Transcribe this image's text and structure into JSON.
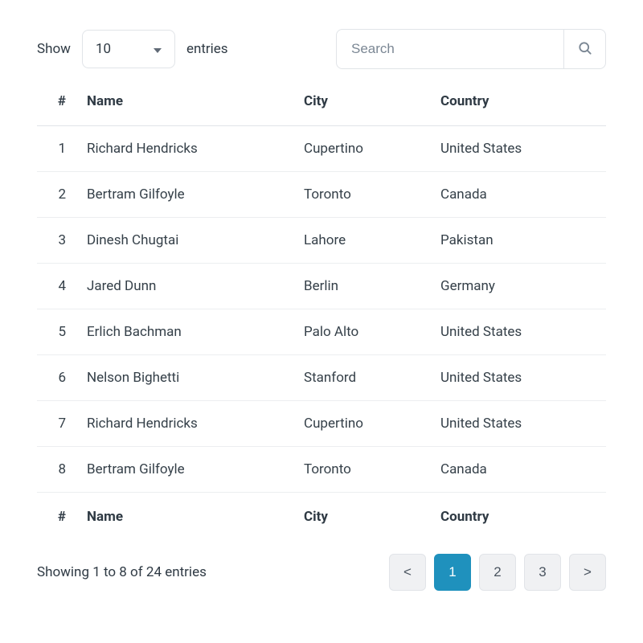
{
  "length": {
    "prefix": "Show",
    "value": "10",
    "suffix": "entries"
  },
  "search": {
    "placeholder": "Search",
    "value": ""
  },
  "columns": {
    "idx": "#",
    "name": "Name",
    "city": "City",
    "country": "Country"
  },
  "rows": [
    {
      "idx": "1",
      "name": "Richard Hendricks",
      "city": "Cupertino",
      "country": "United States"
    },
    {
      "idx": "2",
      "name": "Bertram Gilfoyle",
      "city": "Toronto",
      "country": "Canada"
    },
    {
      "idx": "3",
      "name": "Dinesh Chugtai",
      "city": "Lahore",
      "country": "Pakistan"
    },
    {
      "idx": "4",
      "name": "Jared Dunn",
      "city": "Berlin",
      "country": "Germany"
    },
    {
      "idx": "5",
      "name": "Erlich Bachman",
      "city": "Palo Alto",
      "country": "United States"
    },
    {
      "idx": "6",
      "name": "Nelson Bighetti",
      "city": "Stanford",
      "country": "United States"
    },
    {
      "idx": "7",
      "name": "Richard Hendricks",
      "city": "Cupertino",
      "country": "United States"
    },
    {
      "idx": "8",
      "name": "Bertram Gilfoyle",
      "city": "Toronto",
      "country": "Canada"
    }
  ],
  "info": "Showing 1 to 8 of 24 entries",
  "pager": {
    "prev": "<",
    "next": ">",
    "pages": [
      "1",
      "2",
      "3"
    ],
    "active": "1"
  }
}
